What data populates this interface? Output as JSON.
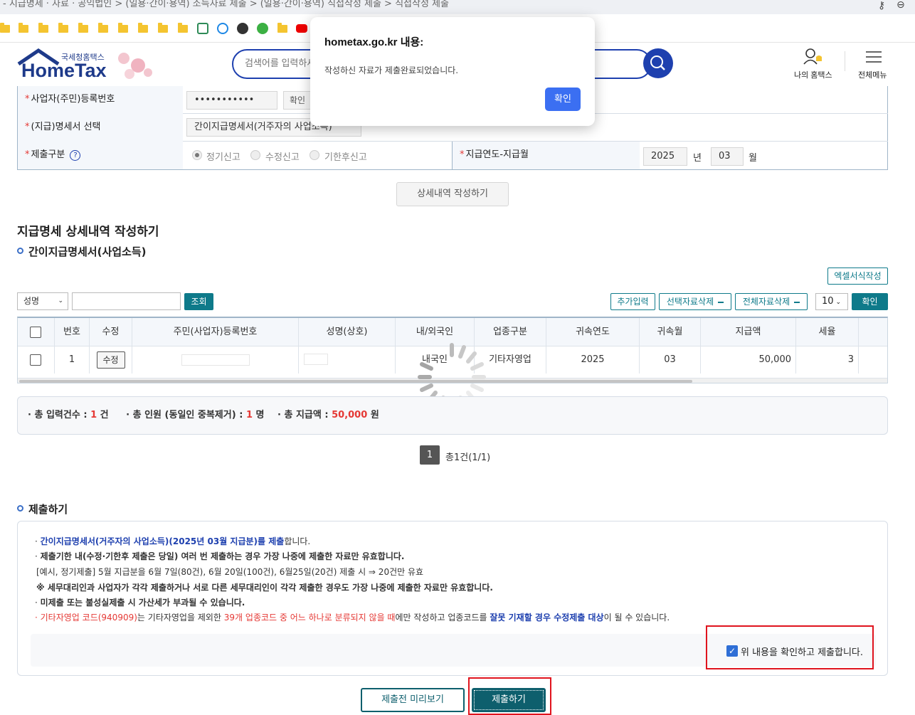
{
  "browser": {
    "breadcrumb": "- 지급명세 · 자료 · 공익법인 > (일용·간이·용역) 소득자료 제출 > (일용·간이·용역) 직접작성 제출 > 직접작성 제출"
  },
  "header": {
    "logo_sub": "국세청홈택스",
    "logo_main": "HomeTax",
    "search_placeholder": "검색어를 입력하세요",
    "my_hometax": "나의 홈택스",
    "all_menu": "전체메뉴"
  },
  "form": {
    "business_no_label": "사업자(주민)등록번호",
    "business_no_value": "•••••••••••",
    "confirm_btn": "확인",
    "statement_label": "(지급)명세서 선택",
    "statement_value": "간이지급명세서(거주자의 사업소득)",
    "submit_type_label": "제출구분",
    "radio_regular": "정기신고",
    "radio_revised": "수정신고",
    "radio_late": "기한후신고",
    "pay_year_month_label": "지급연도-지급월",
    "year": "2025",
    "year_unit": "년",
    "month": "03",
    "month_unit": "월",
    "detail_btn": "상세내역 작성하기"
  },
  "detail": {
    "title": "지급명세 상세내역 작성하기",
    "subtitle": "간이지급명세서(사업소득)",
    "excel_btn": "엑셀서식작성",
    "filter_select": "성명",
    "search_btn": "조회",
    "add_btn": "추가입력",
    "del_selected_btn": "선택자료삭제",
    "del_all_btn": "전체자료삭제",
    "page_size": "10",
    "confirm_btn": "확인",
    "columns": [
      "번호",
      "수정",
      "주민(사업자)등록번호",
      "성명(상호)",
      "내/외국인",
      "업종구분",
      "귀속연도",
      "귀속월",
      "지급액",
      "세율"
    ],
    "rows": [
      {
        "no": "1",
        "edit": "수정",
        "id": "",
        "name": "",
        "foreign": "내국인",
        "industry": "기타자영업",
        "year": "2025",
        "month": "03",
        "amount": "50,000",
        "rate": "3"
      }
    ]
  },
  "summary": {
    "count_label": "총 입력건수 :",
    "count_value": "1",
    "count_unit": "건",
    "people_label": "총 인원 (동일인 중복제거) :",
    "people_value": "1",
    "people_unit": "명",
    "amount_label": "총 지급액 :",
    "amount_value": "50,000",
    "amount_unit": "원"
  },
  "pagination": {
    "current": "1",
    "total_text": "총1건(1/1)"
  },
  "submit": {
    "title": "제출하기",
    "notice_1a": "간이지급명세서(거주자의 사업소득)(2025년 03월 지급분)를 제출",
    "notice_1b": "합니다.",
    "notice_2": "제출기한 내(수정·기한후 제출은 당일) 여러 번 제출하는 경우 가장 나중에 제출한 자료만 유효합니다.",
    "notice_3": "[예시, 정기제출] 5월 지급분을 6월 7일(80건), 6월 20일(100건), 6월25일(20건) 제출 시 ⇒ 20건만 유효",
    "notice_4": "※ 세무대리인과 사업자가 각각 제출하거나 서로 다른 세무대리인이 각각 제출한 경우도 가장 나중에 제출한 자료만 유효합니다.",
    "notice_5": "미제출 또는 불성실제출 시 가산세가 부과될 수 있습니다.",
    "notice_6a": "기타자영업 코드(940909)",
    "notice_6b": "는 기타자영업을 제외한 ",
    "notice_6c": "39개 업종코드 중 어느 하나로 분류되지 않을 때",
    "notice_6d": "에만 작성하고 업종코드를 ",
    "notice_6e": "잘못 기재할 경우 수정제출 대상",
    "notice_6f": "이 될 수 있습니다.",
    "agree_label": "위 내용을 확인하고 제출합니다.",
    "preview_btn": "제출전 미리보기",
    "submit_btn": "제출하기"
  },
  "dialog": {
    "title": "hometax.go.kr 내용:",
    "message": "작성하신 자료가 제출완료되었습니다.",
    "ok": "확인"
  },
  "colors": {
    "teal": "#0e7a8a",
    "navy": "#1e40af",
    "red": "#e53935",
    "dialog_btn": "#3b6ff2"
  }
}
